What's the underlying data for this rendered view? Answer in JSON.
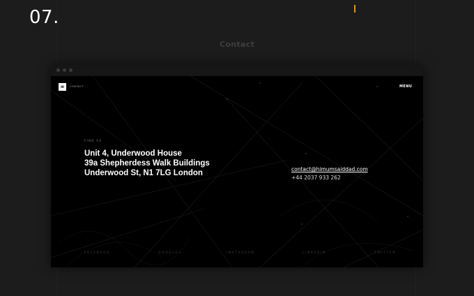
{
  "section": {
    "number": "07.",
    "title": "Contact",
    "accent_color": "#e8940c"
  },
  "site": {
    "logo_mark": "HI",
    "logo_text": "CONTACT",
    "menu_label": "MENU",
    "find_us_label": "FIND US",
    "address": [
      "Unit 4, Underwood House",
      "39a Shepherdess Walk Buildings",
      "Underwood St, N1 7LG London"
    ],
    "email": "contact@himumsaiddad.com",
    "phone": "+44  2037 933 262",
    "social": [
      "FACEBOOK",
      "GOOGLE+",
      "INSTAGRAM",
      "LINKEDIN",
      "TWITTER"
    ]
  }
}
